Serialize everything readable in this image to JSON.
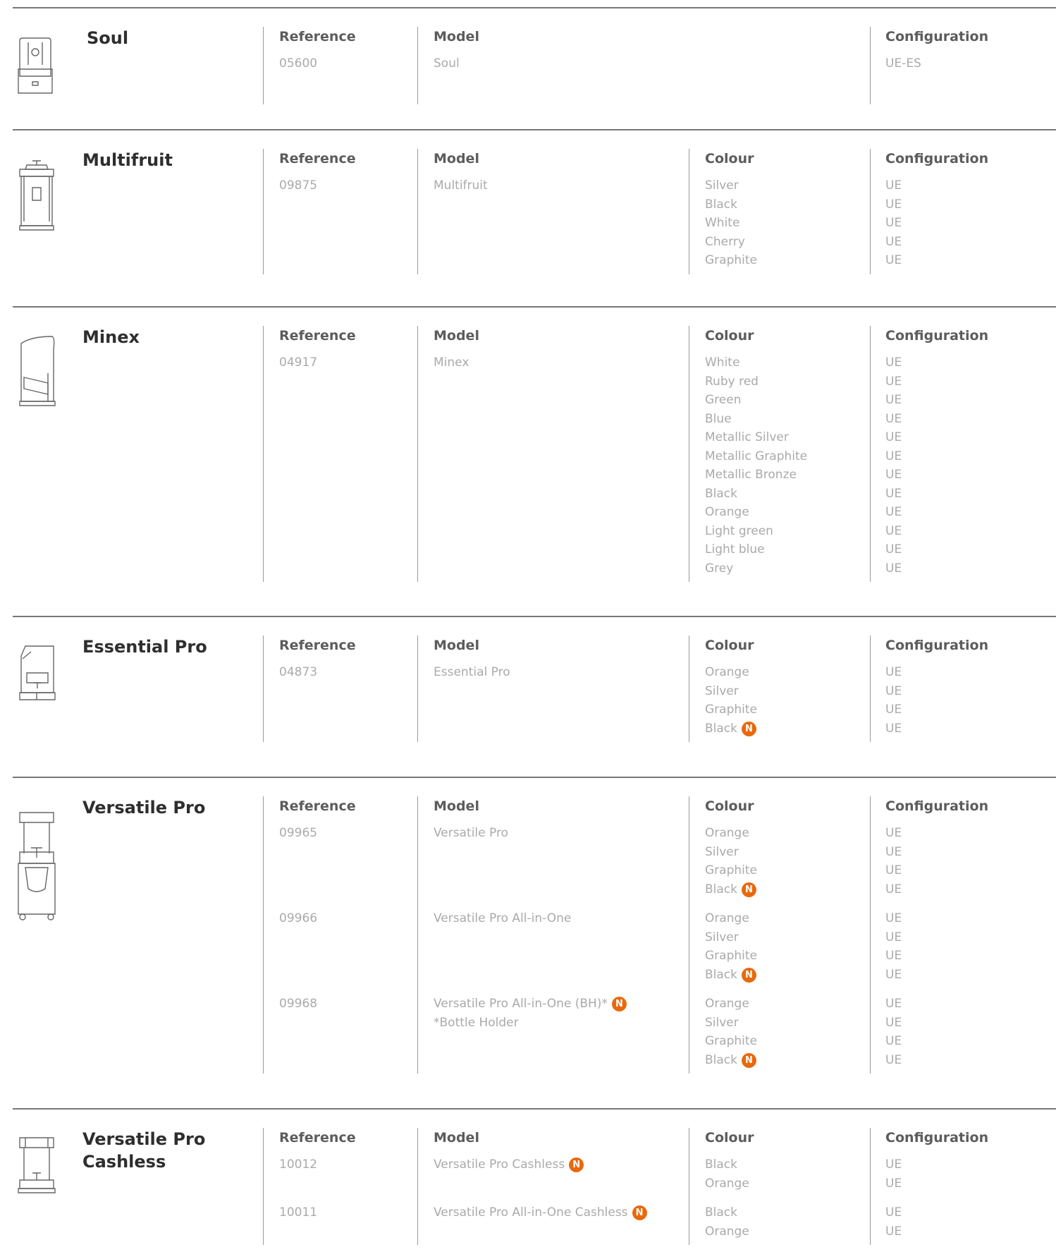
{
  "headers": {
    "reference": "Reference",
    "model": "Model",
    "colour": "Colour",
    "configuration": "Configuration"
  },
  "badge_label": "N",
  "accent_color": "#e8690c",
  "products": [
    {
      "name": "Soul",
      "icon": "soul-juicer-icon",
      "entries": [
        {
          "reference": "05600",
          "model": [
            "Soul"
          ],
          "colours": [],
          "configs": [
            "UE-ES"
          ]
        }
      ]
    },
    {
      "name": "Multifruit",
      "icon": "multifruit-juicer-icon",
      "entries": [
        {
          "reference": "09875",
          "model": [
            "Multifruit"
          ],
          "colours": [
            "Silver",
            "Black",
            "White",
            "Cherry",
            "Graphite"
          ],
          "configs": [
            "UE",
            "UE",
            "UE",
            "UE",
            "UE"
          ]
        }
      ]
    },
    {
      "name": "Minex",
      "icon": "minex-juicer-icon",
      "entries": [
        {
          "reference": "04917",
          "model": [
            "Minex"
          ],
          "colours": [
            "White",
            "Ruby red",
            "Green",
            "Blue",
            "Metallic Silver",
            "Metallic Graphite",
            "Metallic Bronze",
            "Black",
            "Orange",
            "Light green",
            "Light blue",
            "Grey"
          ],
          "configs": [
            "UE",
            "UE",
            "UE",
            "UE",
            "UE",
            "UE",
            "UE",
            "UE",
            "UE",
            "UE",
            "UE",
            "UE"
          ]
        }
      ]
    },
    {
      "name": "Essential Pro",
      "icon": "essential-pro-juicer-icon",
      "entries": [
        {
          "reference": "04873",
          "model": [
            "Essential Pro"
          ],
          "colours": [
            "Orange",
            "Silver",
            "Graphite",
            "Black"
          ],
          "new_colours": [
            3
          ],
          "configs": [
            "UE",
            "UE",
            "UE",
            "UE"
          ]
        }
      ]
    },
    {
      "name": "Versatile Pro",
      "icon": "versatile-pro-juicer-icon",
      "entries": [
        {
          "reference": "09965",
          "model": [
            "Versatile Pro"
          ],
          "colours": [
            "Orange",
            "Silver",
            "Graphite",
            "Black"
          ],
          "new_colours": [
            3
          ],
          "configs": [
            "UE",
            "UE",
            "UE",
            "UE"
          ]
        },
        {
          "reference": "09966",
          "model": [
            "Versatile Pro All-in-One"
          ],
          "colours": [
            "Orange",
            "Silver",
            "Graphite",
            "Black"
          ],
          "new_colours": [
            3
          ],
          "configs": [
            "UE",
            "UE",
            "UE",
            "UE"
          ]
        },
        {
          "reference": "09968",
          "model": [
            "Versatile Pro All-in-One (BH)*",
            "*Bottle Holder"
          ],
          "model_new": true,
          "colours": [
            "Orange",
            "Silver",
            "Graphite",
            "Black"
          ],
          "new_colours": [
            3
          ],
          "configs": [
            "UE",
            "UE",
            "UE",
            "UE"
          ]
        }
      ]
    },
    {
      "name": "Versatile Pro\nCashless",
      "icon": "versatile-pro-cashless-juicer-icon",
      "entries": [
        {
          "reference": "10012",
          "model": [
            "Versatile Pro Cashless"
          ],
          "model_new": true,
          "colours": [
            "Black",
            "Orange"
          ],
          "configs": [
            "UE",
            "UE"
          ]
        },
        {
          "reference": "10011",
          "model": [
            "Versatile Pro All-in-One Cashless"
          ],
          "model_new": true,
          "colours": [
            "Black",
            "Orange"
          ],
          "configs": [
            "UE",
            "UE"
          ]
        }
      ]
    }
  ]
}
